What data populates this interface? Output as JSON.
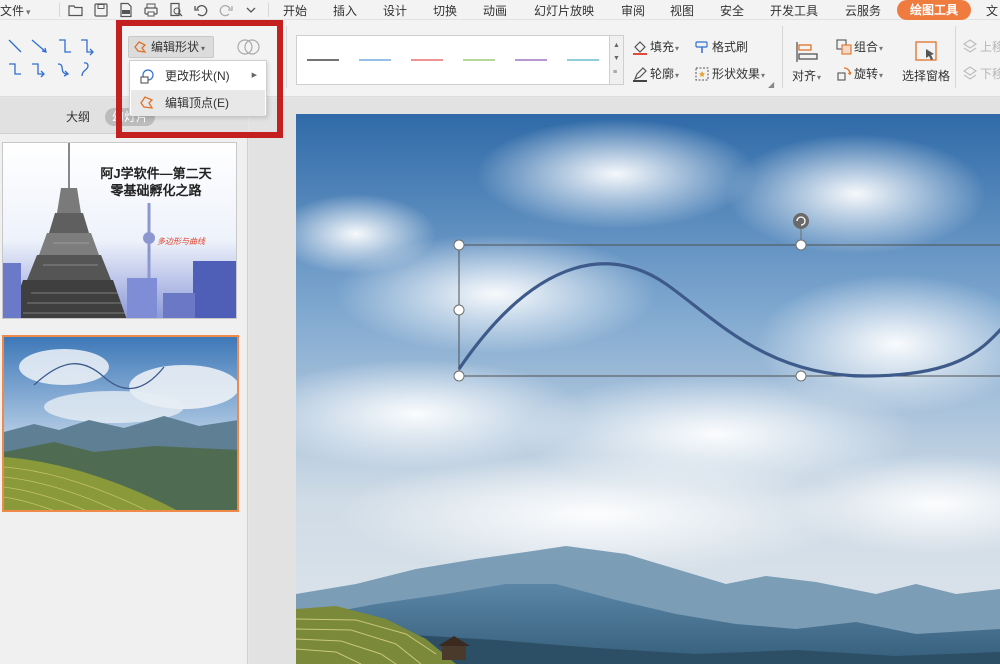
{
  "menubar": {
    "file_label": "文件",
    "items": [
      "开始",
      "插入",
      "设计",
      "切换",
      "动画",
      "幻灯片放映",
      "审阅",
      "视图",
      "安全",
      "开发工具",
      "云服务"
    ],
    "active_tab": "绘图工具",
    "accent_color": "#f07b3f"
  },
  "ribbon": {
    "edit_shape_label": "编辑形状",
    "fill_label": "填充",
    "format_painter_label": "格式刷",
    "outline_label": "轮廓",
    "shape_effects_label": "形状效果",
    "align_label": "对齐",
    "group_label": "组合",
    "rotate_label": "旋转",
    "selection_pane_label": "选择窗格",
    "bring_forward_label": "上移",
    "send_backward_label": "下移",
    "line_style_colors": [
      "#222222",
      "#5b9bd5",
      "#e05555",
      "#8cbf5a",
      "#8e5bb5",
      "#4fb0c6"
    ]
  },
  "dropdown": {
    "items": [
      {
        "label": "更改形状(N)",
        "has_submenu": true
      },
      {
        "label": "编辑顶点(E)",
        "has_submenu": false
      }
    ],
    "highlight_color": "#c42020"
  },
  "leftpanel": {
    "tab_outline": "大纲",
    "tab_slides": "幻灯片",
    "slide1_title_line1": "阿J学软件—第二天",
    "slide1_title_line2": "零基础孵化之路",
    "slide1_subtitle": "多边形与曲线"
  },
  "canvas": {
    "curve_color": "#3d5a8a"
  }
}
